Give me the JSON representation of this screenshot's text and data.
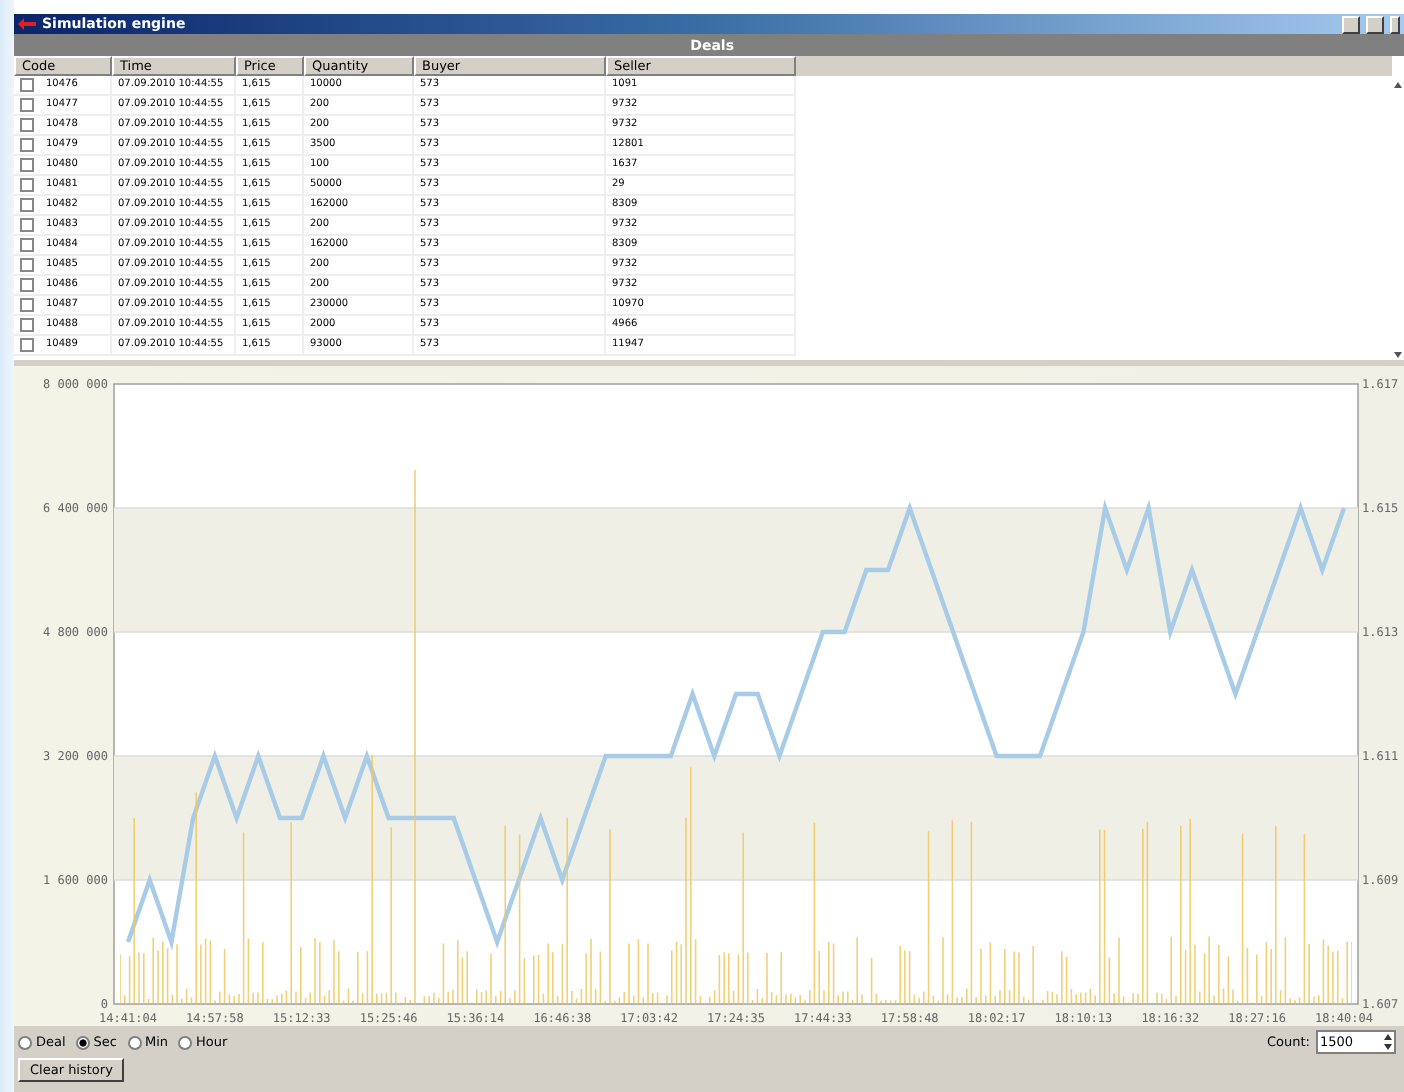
{
  "window": {
    "title": "Simulation engine"
  },
  "deals": {
    "title": "Deals",
    "columns": [
      "Code",
      "Time",
      "Price",
      "Quantity",
      "Buyer",
      "Seller"
    ],
    "rows": [
      [
        "10476",
        "07.09.2010 10:44:55",
        "1,615",
        "10000",
        "573",
        "1091"
      ],
      [
        "10477",
        "07.09.2010 10:44:55",
        "1,615",
        "200",
        "573",
        "9732"
      ],
      [
        "10478",
        "07.09.2010 10:44:55",
        "1,615",
        "200",
        "573",
        "9732"
      ],
      [
        "10479",
        "07.09.2010 10:44:55",
        "1,615",
        "3500",
        "573",
        "12801"
      ],
      [
        "10480",
        "07.09.2010 10:44:55",
        "1,615",
        "100",
        "573",
        "1637"
      ],
      [
        "10481",
        "07.09.2010 10:44:55",
        "1,615",
        "50000",
        "573",
        "29"
      ],
      [
        "10482",
        "07.09.2010 10:44:55",
        "1,615",
        "162000",
        "573",
        "8309"
      ],
      [
        "10483",
        "07.09.2010 10:44:55",
        "1,615",
        "200",
        "573",
        "9732"
      ],
      [
        "10484",
        "07.09.2010 10:44:55",
        "1,615",
        "162000",
        "573",
        "8309"
      ],
      [
        "10485",
        "07.09.2010 10:44:55",
        "1,615",
        "200",
        "573",
        "9732"
      ],
      [
        "10486",
        "07.09.2010 10:44:55",
        "1,615",
        "200",
        "573",
        "9732"
      ],
      [
        "10487",
        "07.09.2010 10:44:55",
        "1,615",
        "230000",
        "573",
        "10970"
      ],
      [
        "10488",
        "07.09.2010 10:44:55",
        "1,615",
        "2000",
        "573",
        "4966"
      ],
      [
        "10489",
        "07.09.2010 10:44:55",
        "1,615",
        "93000",
        "573",
        "11947"
      ]
    ]
  },
  "chart": {
    "left_axis_labels": [
      "8 000 000",
      "6 400 000",
      "4 800 000",
      "3 200 000",
      "1 600 000",
      "0"
    ],
    "chart_data": {
      "type": "line",
      "grid": true,
      "ylim": [
        1.607,
        1.617
      ],
      "yticks": [
        1.607,
        1.609,
        1.611,
        1.613,
        1.615,
        1.617
      ],
      "categories": [
        "14:41:04",
        null,
        null,
        null,
        "14:57:58",
        null,
        null,
        null,
        "15:12:33",
        null,
        null,
        null,
        "15:25:46",
        null,
        null,
        null,
        "15:36:14",
        null,
        null,
        null,
        "16:46:38",
        null,
        null,
        null,
        "17:03:42",
        null,
        null,
        null,
        "17:24:35",
        null,
        null,
        null,
        "17:44:33",
        null,
        null,
        null,
        "17:58:48",
        null,
        null,
        null,
        "18:02:17",
        null,
        null,
        null,
        "18:10:13",
        null,
        null,
        null,
        "18:16:32",
        null,
        null,
        null,
        "18:27:16",
        null,
        null,
        null,
        "18:40:04"
      ],
      "series": [
        {
          "color": "#a8cce8",
          "values": [
            1.608,
            1.609,
            1.608,
            1.61,
            1.611,
            1.61,
            1.611,
            1.61,
            1.61,
            1.611,
            1.61,
            1.611,
            1.61,
            1.61,
            1.61,
            1.61,
            1.609,
            1.608,
            1.609,
            1.61,
            1.609,
            1.61,
            1.611,
            1.611,
            1.611,
            1.611,
            1.612,
            1.611,
            1.612,
            1.612,
            1.611,
            1.612,
            1.613,
            1.613,
            1.614,
            1.614,
            1.615,
            1.614,
            1.613,
            1.612,
            1.611,
            1.611,
            1.611,
            1.612,
            1.613,
            1.615,
            1.614,
            1.615,
            1.613,
            1.614,
            1.613,
            1.612,
            1.613,
            1.614,
            1.615,
            1.614,
            1.615
          ]
        }
      ]
    }
  },
  "interval": [
    {
      "label": "Deal",
      "selected": false
    },
    {
      "label": "Sec",
      "selected": true
    },
    {
      "label": "Min",
      "selected": false
    },
    {
      "label": "Hour",
      "selected": false
    }
  ],
  "count": {
    "label": "Count:",
    "value": "1500"
  },
  "buttons": [
    "Clear history"
  ]
}
